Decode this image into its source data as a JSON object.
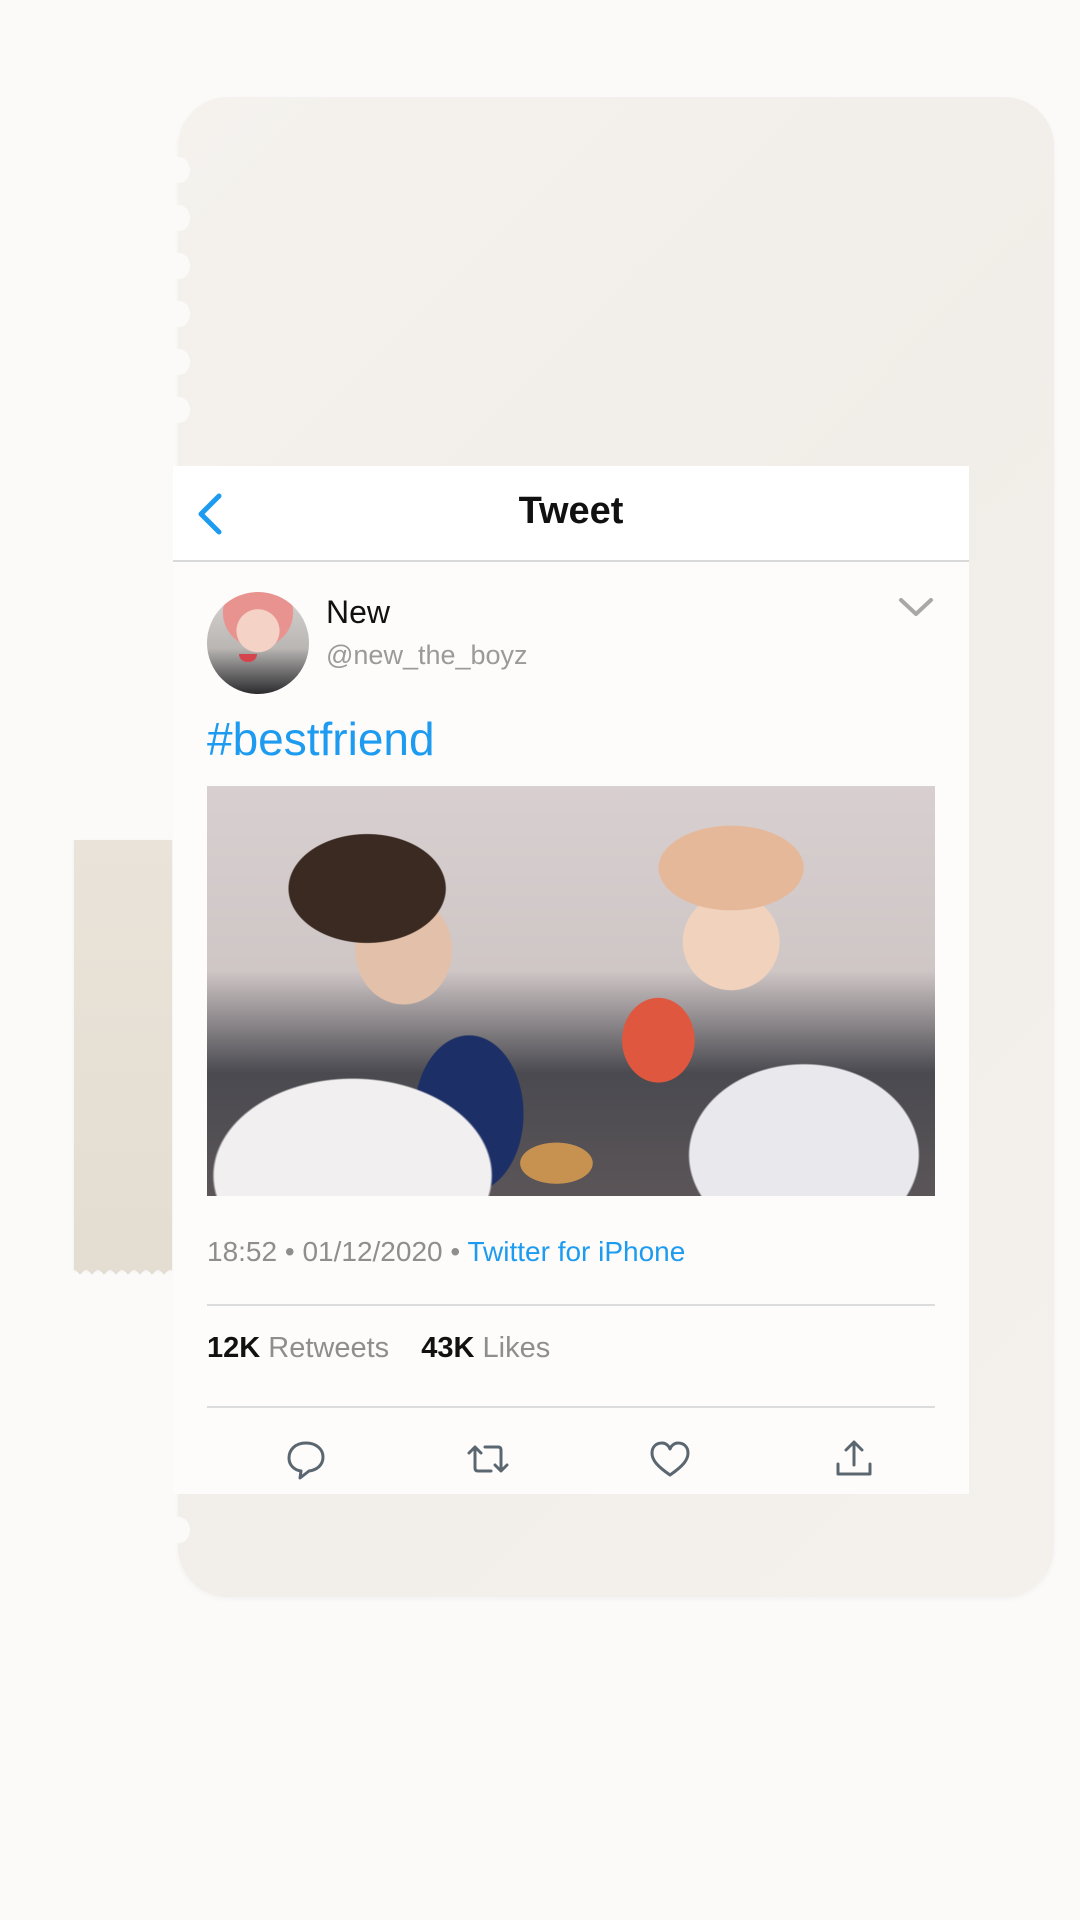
{
  "header": {
    "title": "Tweet",
    "back_icon": "chevron-left-icon"
  },
  "tweet": {
    "user_name": "New",
    "user_handle": "@new_the_boyz",
    "hashtag": "#bestfriend",
    "time": "18:52",
    "date": "01/12/2020",
    "source": "Twitter for iPhone",
    "retweets_count": "12K",
    "retweets_label": "Retweets",
    "likes_count": "43K",
    "likes_label": "Likes"
  },
  "actions": [
    "reply-icon",
    "retweet-icon",
    "like-icon",
    "share-icon"
  ],
  "colors": {
    "accent": "#1d9bf0",
    "muted_text": "#8e8e8e",
    "icon_gray": "#5b6770",
    "paper": "#f3f0ec"
  }
}
